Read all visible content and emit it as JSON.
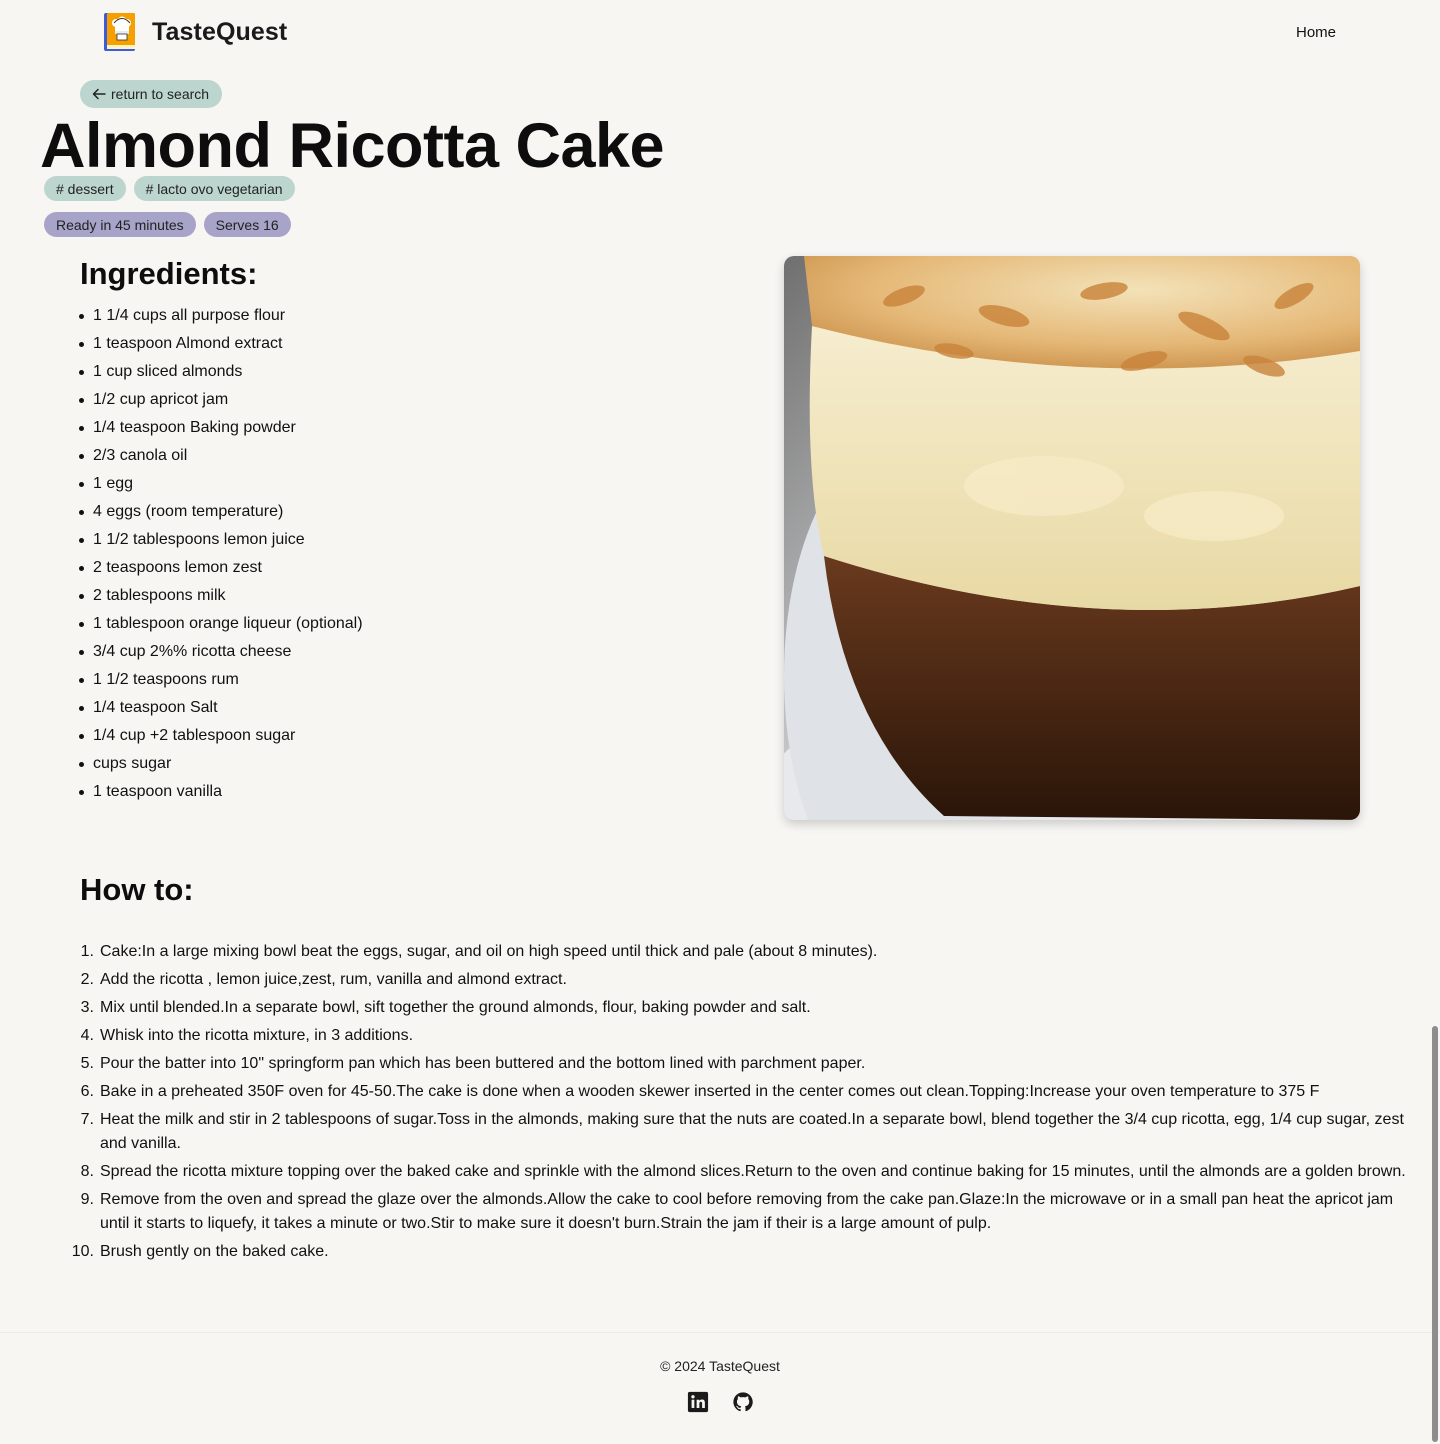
{
  "header": {
    "brand_name": "TasteQuest",
    "nav_home": "Home"
  },
  "back_label": "return to search",
  "recipe": {
    "title": "Almond Ricotta Cake",
    "tags": [
      "# dessert",
      "# lacto ovo vegetarian"
    ],
    "ready": "Ready in 45 minutes",
    "serves": "Serves 16",
    "ingredients_heading": "Ingredients:",
    "ingredients": [
      "1 1/4 cups all purpose flour",
      "1 teaspoon Almond extract",
      "1 cup sliced almonds",
      "1/2 cup apricot jam",
      "1/4 teaspoon Baking powder",
      "2/3 canola oil",
      "1 egg",
      "4 eggs (room temperature)",
      "1 1/2 tablespoons lemon juice",
      "2 teaspoons lemon zest",
      "2 tablespoons milk",
      "1 tablespoon orange liqueur (optional)",
      "3/4 cup 2%% ricotta cheese",
      "1 1/2 teaspoons rum",
      "1/4 teaspoon Salt",
      "1/4 cup +2 tablespoon sugar",
      "cups sugar",
      "1 teaspoon vanilla"
    ],
    "howto_heading": "How to:",
    "steps": [
      "Cake:In a large mixing bowl beat the eggs, sugar, and oil on high speed until thick and pale (about 8 minutes).",
      "Add the ricotta , lemon juice,zest, rum, vanilla and almond extract.",
      "Mix until blended.In a separate bowl, sift together the ground almonds, flour, baking powder and salt.",
      "Whisk into the ricotta mixture, in 3 additions.",
      "Pour the batter into 10\" springform pan which has been buttered and the bottom lined with parchment paper.",
      "Bake in a preheated 350F oven for 45-50.The cake is done when a wooden skewer inserted in the center comes out clean.Topping:Increase your oven temperature to 375 F",
      "Heat the milk and stir in 2 tablespoons of sugar.Toss in the almonds, making sure that the nuts are coated.In a separate bowl, blend together the 3/4 cup ricotta, egg, 1/4 cup sugar, zest and vanilla.",
      "Spread the ricotta mixture topping over the baked cake and sprinkle with the almond slices.Return to the oven and continue baking for 15 minutes, until the almonds are a golden brown.",
      "Remove from the oven and spread the glaze over the almonds.Allow the cake to cool before removing from the cake pan.Glaze:In the microwave or in a small pan heat the apricot jam until it starts to liquefy, it takes a minute or two.Stir to make sure it doesn't burn.Strain the jam if their is a large amount of pulp.",
      "Brush gently on the baked cake."
    ]
  },
  "footer": {
    "copyright": "© 2024 TasteQuest",
    "social": [
      "linkedin-icon",
      "github-icon"
    ]
  },
  "colors": {
    "background": "#f7f6f3",
    "tag_green": "#bcd6cf",
    "tag_purple": "#a8a3c8"
  }
}
